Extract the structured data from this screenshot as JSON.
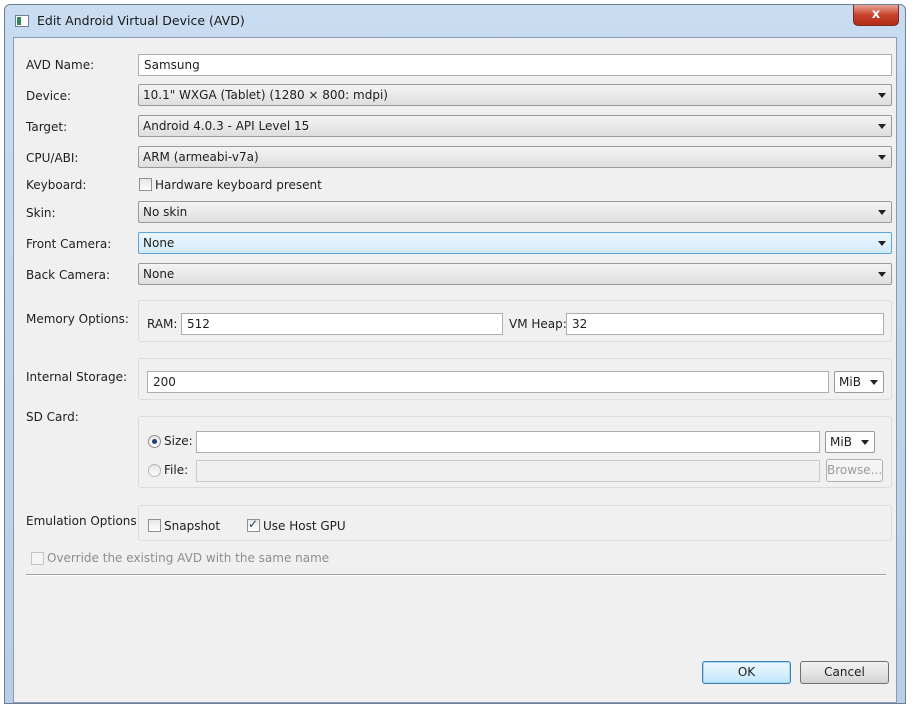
{
  "window": {
    "title": "Edit Android Virtual Device (AVD)",
    "close_label": "x"
  },
  "form": {
    "avd_name": {
      "label": "AVD Name:",
      "value": "Samsung"
    },
    "device": {
      "label": "Device:",
      "value": "10.1\" WXGA (Tablet) (1280 × 800: mdpi)"
    },
    "target": {
      "label": "Target:",
      "value": "Android 4.0.3 - API Level 15"
    },
    "cpu_abi": {
      "label": "CPU/ABI:",
      "value": "ARM (armeabi-v7a)"
    },
    "keyboard": {
      "label": "Keyboard:",
      "checkbox_label": "Hardware keyboard present",
      "checked": false
    },
    "skin": {
      "label": "Skin:",
      "value": "No skin"
    },
    "front_camera": {
      "label": "Front Camera:",
      "value": "None"
    },
    "back_camera": {
      "label": "Back Camera:",
      "value": "None"
    },
    "memory": {
      "label": "Memory Options:",
      "ram_label": "RAM:",
      "ram_value": "512",
      "vm_heap_label": "VM Heap:",
      "vm_heap_value": "32"
    },
    "internal_storage": {
      "label": "Internal Storage:",
      "value": "200",
      "unit": "MiB"
    },
    "sd_card": {
      "label": "SD Card:",
      "size_label": "Size:",
      "size_value": "",
      "size_unit": "MiB",
      "size_selected": true,
      "file_label": "File:",
      "file_value": "",
      "browse_label": "Browse..."
    },
    "emulation": {
      "label": "Emulation Options:",
      "snapshot_label": "Snapshot",
      "snapshot_checked": false,
      "host_gpu_label": "Use Host GPU",
      "host_gpu_checked": true
    },
    "override": {
      "label": "Override the existing AVD with the same name",
      "checked": false,
      "enabled": false
    }
  },
  "buttons": {
    "ok": "OK",
    "cancel": "Cancel"
  },
  "colors": {
    "titlebar": "#c9dcf1",
    "client_bg": "#f0f0f0",
    "close_red": "#c7432c",
    "focus_blue": "#5aa6d7"
  }
}
